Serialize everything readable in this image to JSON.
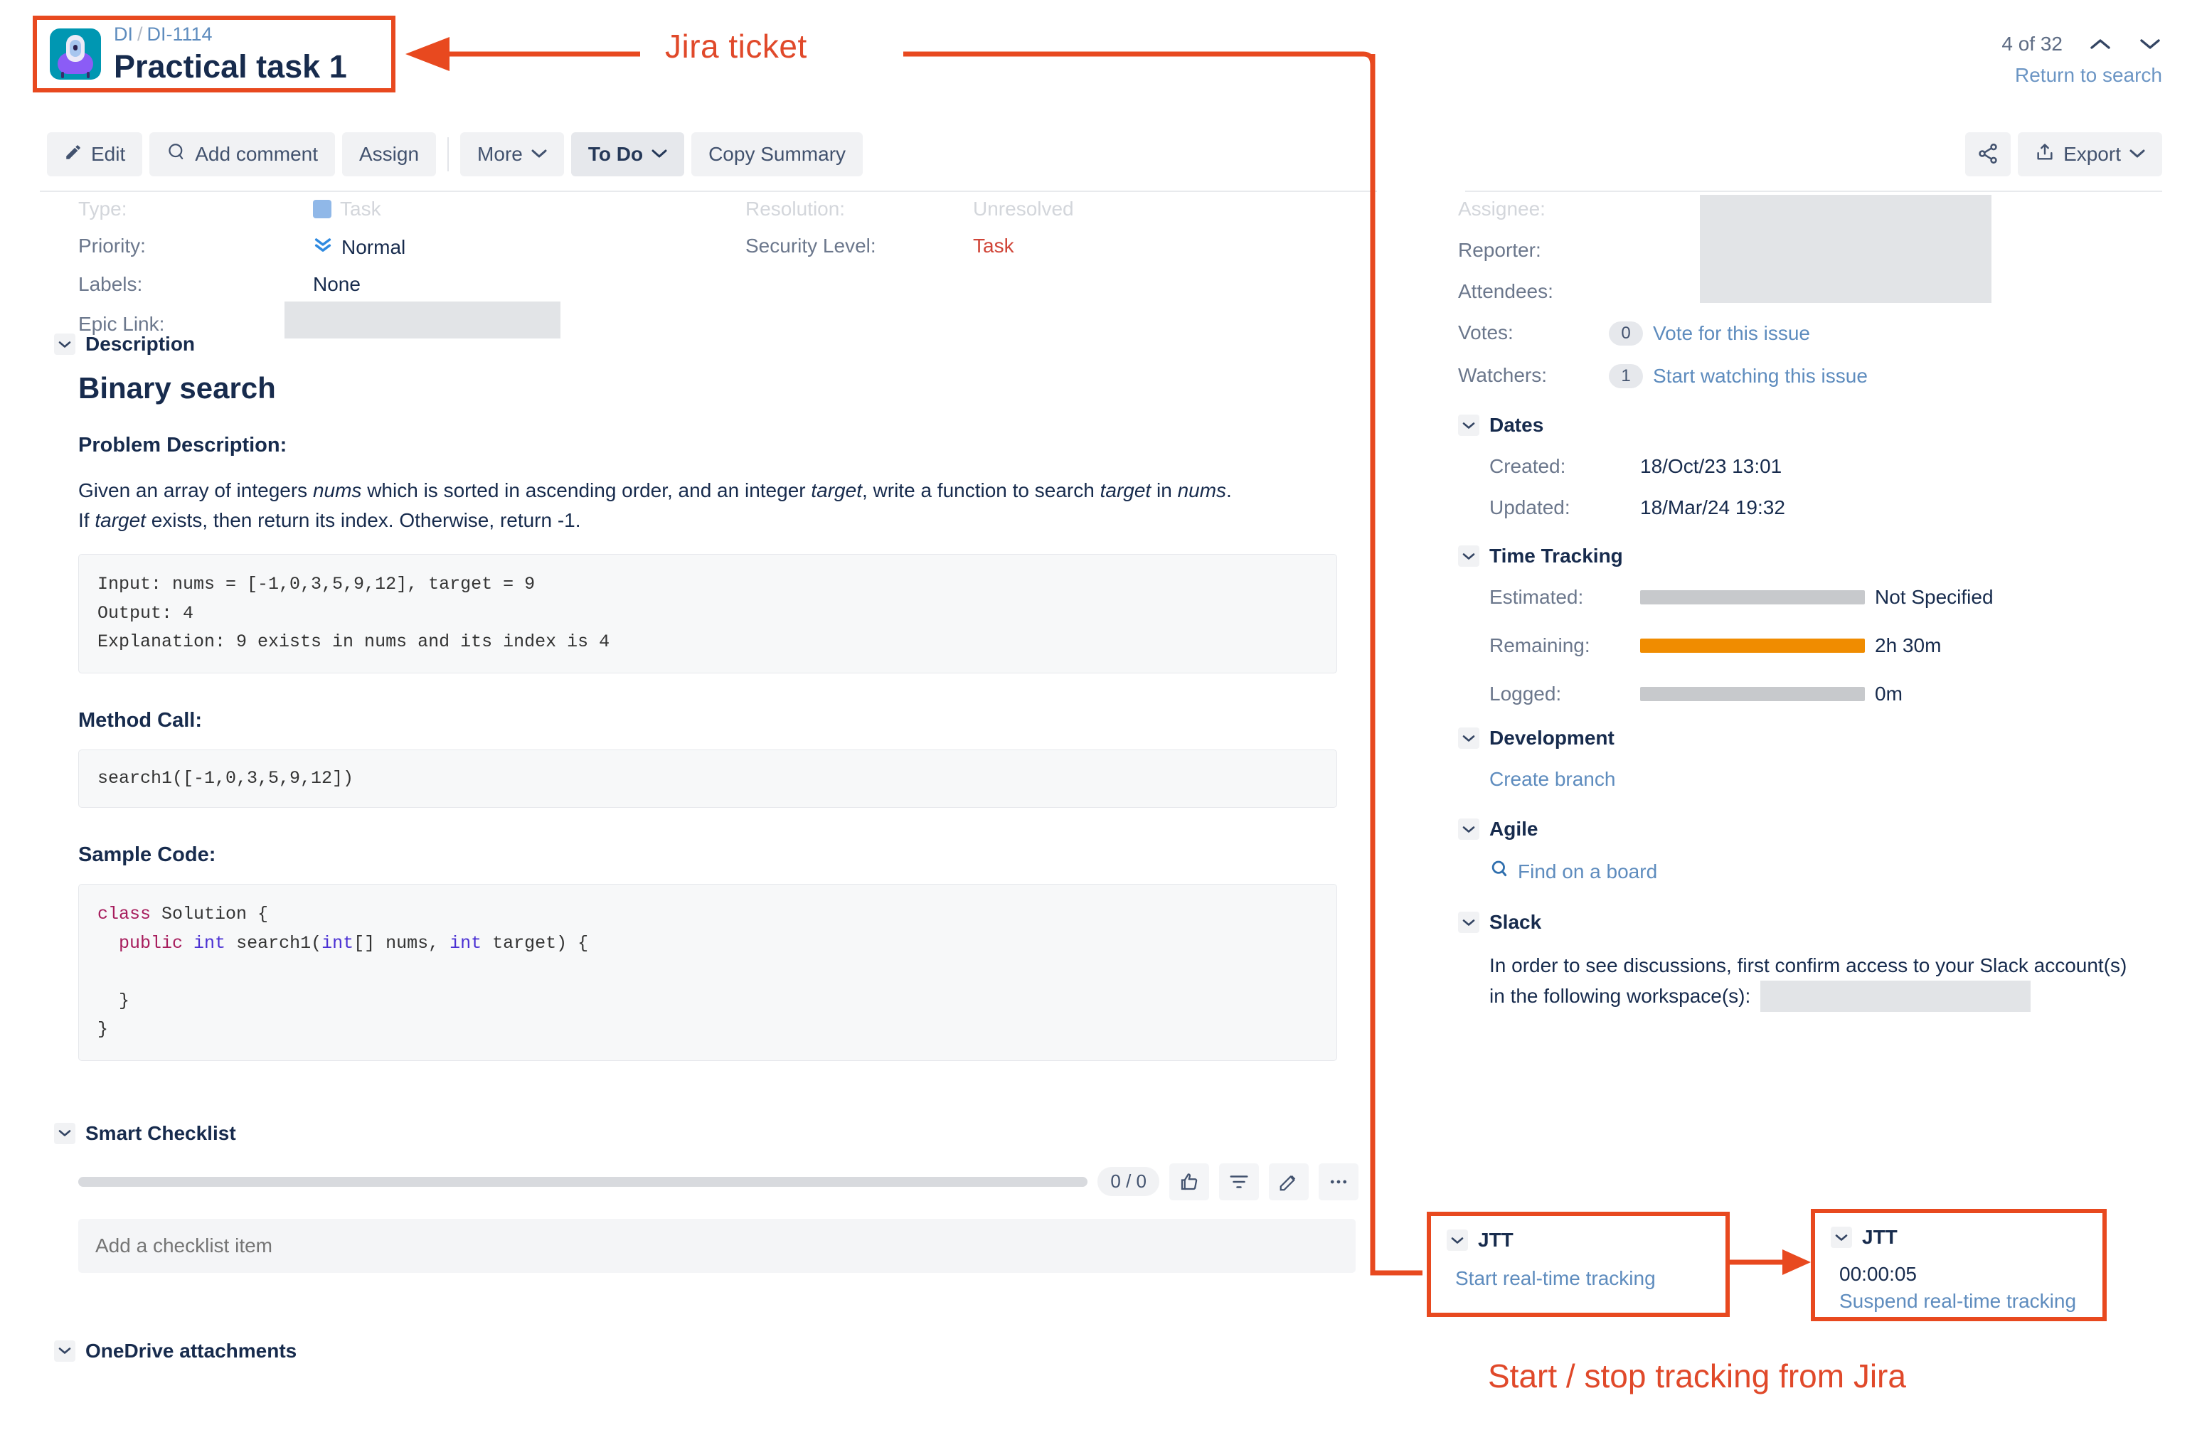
{
  "annotations": {
    "top_label": "Jira ticket",
    "bottom_label": "Start / stop tracking from Jira"
  },
  "header": {
    "breadcrumb_project": "DI",
    "breadcrumb_separator": "/",
    "breadcrumb_key": "DI-1114",
    "issue_title": "Practical task 1",
    "pager_count": "4 of 32",
    "return_to_search": "Return to search"
  },
  "toolbar": {
    "edit": "Edit",
    "add_comment": "Add comment",
    "assign": "Assign",
    "more": "More",
    "status": "To Do",
    "copy_summary": "Copy Summary",
    "export": "Export"
  },
  "details": {
    "type_label": "Type:",
    "type_value": "Task",
    "priority_label": "Priority:",
    "priority_value": "Normal",
    "labels_label": "Labels:",
    "labels_value": "None",
    "epic_link_label": "Epic Link:",
    "resolution_label": "Resolution:",
    "resolution_value": "Unresolved",
    "security_label": "Security Level:",
    "security_value": "Task"
  },
  "description": {
    "section_title": "Description",
    "heading": "Binary search",
    "problem_heading": "Problem Description:",
    "paragraph_line1_a": "Given an array of integers ",
    "paragraph_line1_i1": "nums",
    "paragraph_line1_b": " which is sorted in ascending order, and an integer ",
    "paragraph_line1_i2": "target",
    "paragraph_line1_c": ", write a function to search ",
    "paragraph_line1_i3": "target",
    "paragraph_line1_d": " in ",
    "paragraph_line1_i4": "nums",
    "paragraph_line1_e": ".",
    "paragraph_line2_a": "If ",
    "paragraph_line2_i1": "target",
    "paragraph_line2_b": " exists, then return its index. Otherwise, return -1.",
    "example_code": "Input: nums = [-1,0,3,5,9,12], target = 9\nOutput: 4\nExplanation: 9 exists in nums and its index is 4",
    "method_call_heading": "Method Call:",
    "method_call_code": "search1([-1,0,3,5,9,12])",
    "sample_code_heading": "Sample Code:",
    "sample_code_l1_kw": "class",
    "sample_code_l1_rest": " Solution {",
    "sample_code_l2_kw": "public",
    "sample_code_l2_t1": "int",
    "sample_code_l2_mid": " search1(",
    "sample_code_l2_t2": "int",
    "sample_code_l2_mid2": "[] nums, ",
    "sample_code_l2_t3": "int",
    "sample_code_l2_end": " target) {",
    "sample_code_l3": "",
    "sample_code_l4": "  }",
    "sample_code_l5": "}"
  },
  "checklist": {
    "section_title": "Smart Checklist",
    "count": "0 / 0",
    "add_placeholder": "Add a checklist item"
  },
  "onedrive": {
    "section_title": "OneDrive attachments"
  },
  "people": {
    "assignee_label": "Assignee:",
    "reporter_label": "Reporter:",
    "attendees_label": "Attendees:",
    "votes_label": "Votes:",
    "votes_count": "0",
    "votes_link": "Vote for this issue",
    "watchers_label": "Watchers:",
    "watchers_count": "1",
    "watchers_link": "Start watching this issue"
  },
  "dates": {
    "section_title": "Dates",
    "created_label": "Created:",
    "created_value": "18/Oct/23 13:01",
    "updated_label": "Updated:",
    "updated_value": "18/Mar/24 19:32"
  },
  "time_tracking": {
    "section_title": "Time Tracking",
    "estimated_label": "Estimated:",
    "estimated_value": "Not Specified",
    "remaining_label": "Remaining:",
    "remaining_value": "2h 30m",
    "logged_label": "Logged:",
    "logged_value": "0m",
    "remaining_bar_color": "#f08c00",
    "empty_bar_color": "#c7c9cc"
  },
  "development": {
    "section_title": "Development",
    "create_branch": "Create branch"
  },
  "agile": {
    "section_title": "Agile",
    "find_on_board": "Find on a board"
  },
  "slack": {
    "section_title": "Slack",
    "text_line1": "In order to see discussions, first confirm access to your Slack account(s)",
    "text_line2": "in the following workspace(s):"
  },
  "jtt_before": {
    "section_title": "JTT",
    "action": "Start real-time tracking"
  },
  "jtt_after": {
    "section_title": "JTT",
    "timer": "00:00:05",
    "action": "Suspend real-time tracking"
  },
  "colors": {
    "annotation": "#e8491f",
    "link": "#5e8cbe",
    "danger": "#d04437"
  }
}
